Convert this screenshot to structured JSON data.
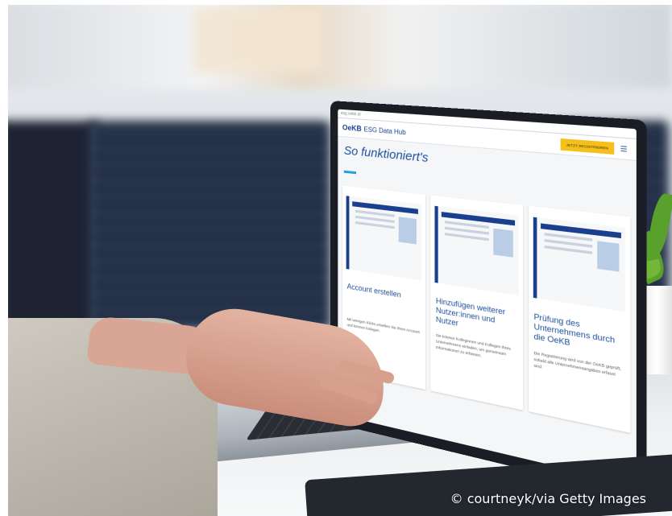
{
  "screen": {
    "url": "esg.oekb.at",
    "logo": "OeKB",
    "logo_subtitle": "ESG Data Hub",
    "cta_label": "JETZT REGISTRIEREN",
    "hero_title": "So funktioniert's",
    "cards": [
      {
        "title": "Account erstellen",
        "text": "Mit wenigen Klicks erstellen Sie Ihren Account und können loslegen."
      },
      {
        "title": "Hinzufügen weiterer Nutzer:innen und Nutzer",
        "text": "Sie können Kolleginnen und Kollegen Ihres Unternehmens einladen, um gemeinsam Informationen zu erfassen."
      },
      {
        "title": "Prüfung des Unternehmens durch die OeKB",
        "text": "Die Registrierung wird von der OeKB geprüft, sobald alle Unternehmensangaben erfasst sind."
      }
    ]
  },
  "credit": "© courtneyk/via Getty Images",
  "colors": {
    "brand_blue": "#14408c",
    "cta_yellow": "#f5bf1c",
    "accent_cyan": "#1fa3e0"
  }
}
